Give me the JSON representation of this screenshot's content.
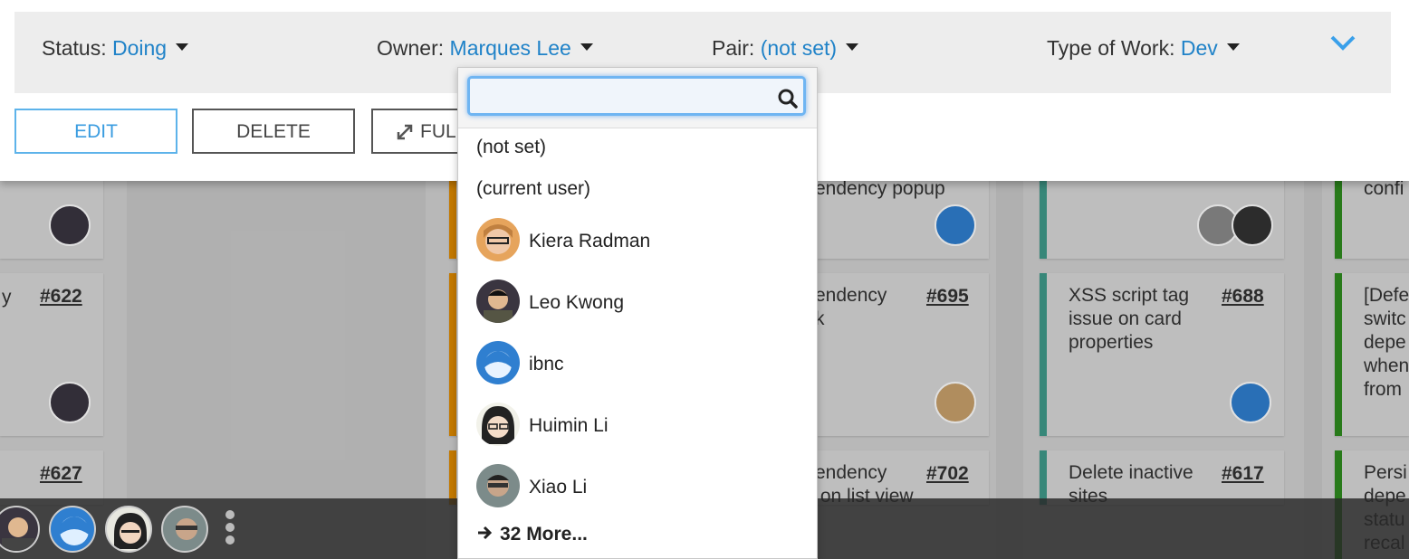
{
  "fields": {
    "status": {
      "label": "Status:",
      "value": "Doing"
    },
    "owner": {
      "label": "Owner:",
      "value": "Marques Lee"
    },
    "pair": {
      "label": "Pair:",
      "value": "(not set)"
    },
    "type_of_work": {
      "label": "Type of Work:",
      "value": "Dev"
    }
  },
  "buttons": {
    "edit": "EDIT",
    "delete": "DELETE",
    "full": "FUL"
  },
  "dropdown": {
    "search_value": "",
    "options": [
      {
        "label": "(not set)"
      },
      {
        "label": "(current user)"
      },
      {
        "label": "Kiera Radman",
        "icon": "avatar-kiera"
      },
      {
        "label": "Leo Kwong",
        "icon": "avatar-leo"
      },
      {
        "label": "ibnc",
        "icon": "avatar-ibnc"
      },
      {
        "label": "Huimin Li",
        "icon": "avatar-huimin"
      },
      {
        "label": "Xiao Li",
        "icon": "avatar-xiao"
      }
    ],
    "more": "32 More..."
  },
  "board": {
    "cards": [
      {
        "num": "#622",
        "title": "y"
      },
      {
        "num": "#627",
        "title": ""
      },
      {
        "num": "#695",
        "title": "endency\nk"
      },
      {
        "num": "#702",
        "title": "endency\n on list view"
      },
      {
        "num": "#688",
        "title": "XSS script tag\nissue on card\nproperties"
      },
      {
        "num": "#617",
        "title": "Delete inactive\nsites"
      },
      {
        "num": "",
        "title": "endency popup"
      },
      {
        "num": "",
        "title": "confi"
      },
      {
        "num": "",
        "title": "[Defe\nswitc\ndepe\nwhen\nfrom"
      },
      {
        "num": "",
        "title": "Persi\ndepe\nstatu\nrecal"
      }
    ]
  },
  "colors": {
    "accent": "#1f82c8",
    "lane_orange": "#e08a00",
    "lane_teal": "#3f9a8a",
    "lane_green": "#2e8b1e"
  }
}
